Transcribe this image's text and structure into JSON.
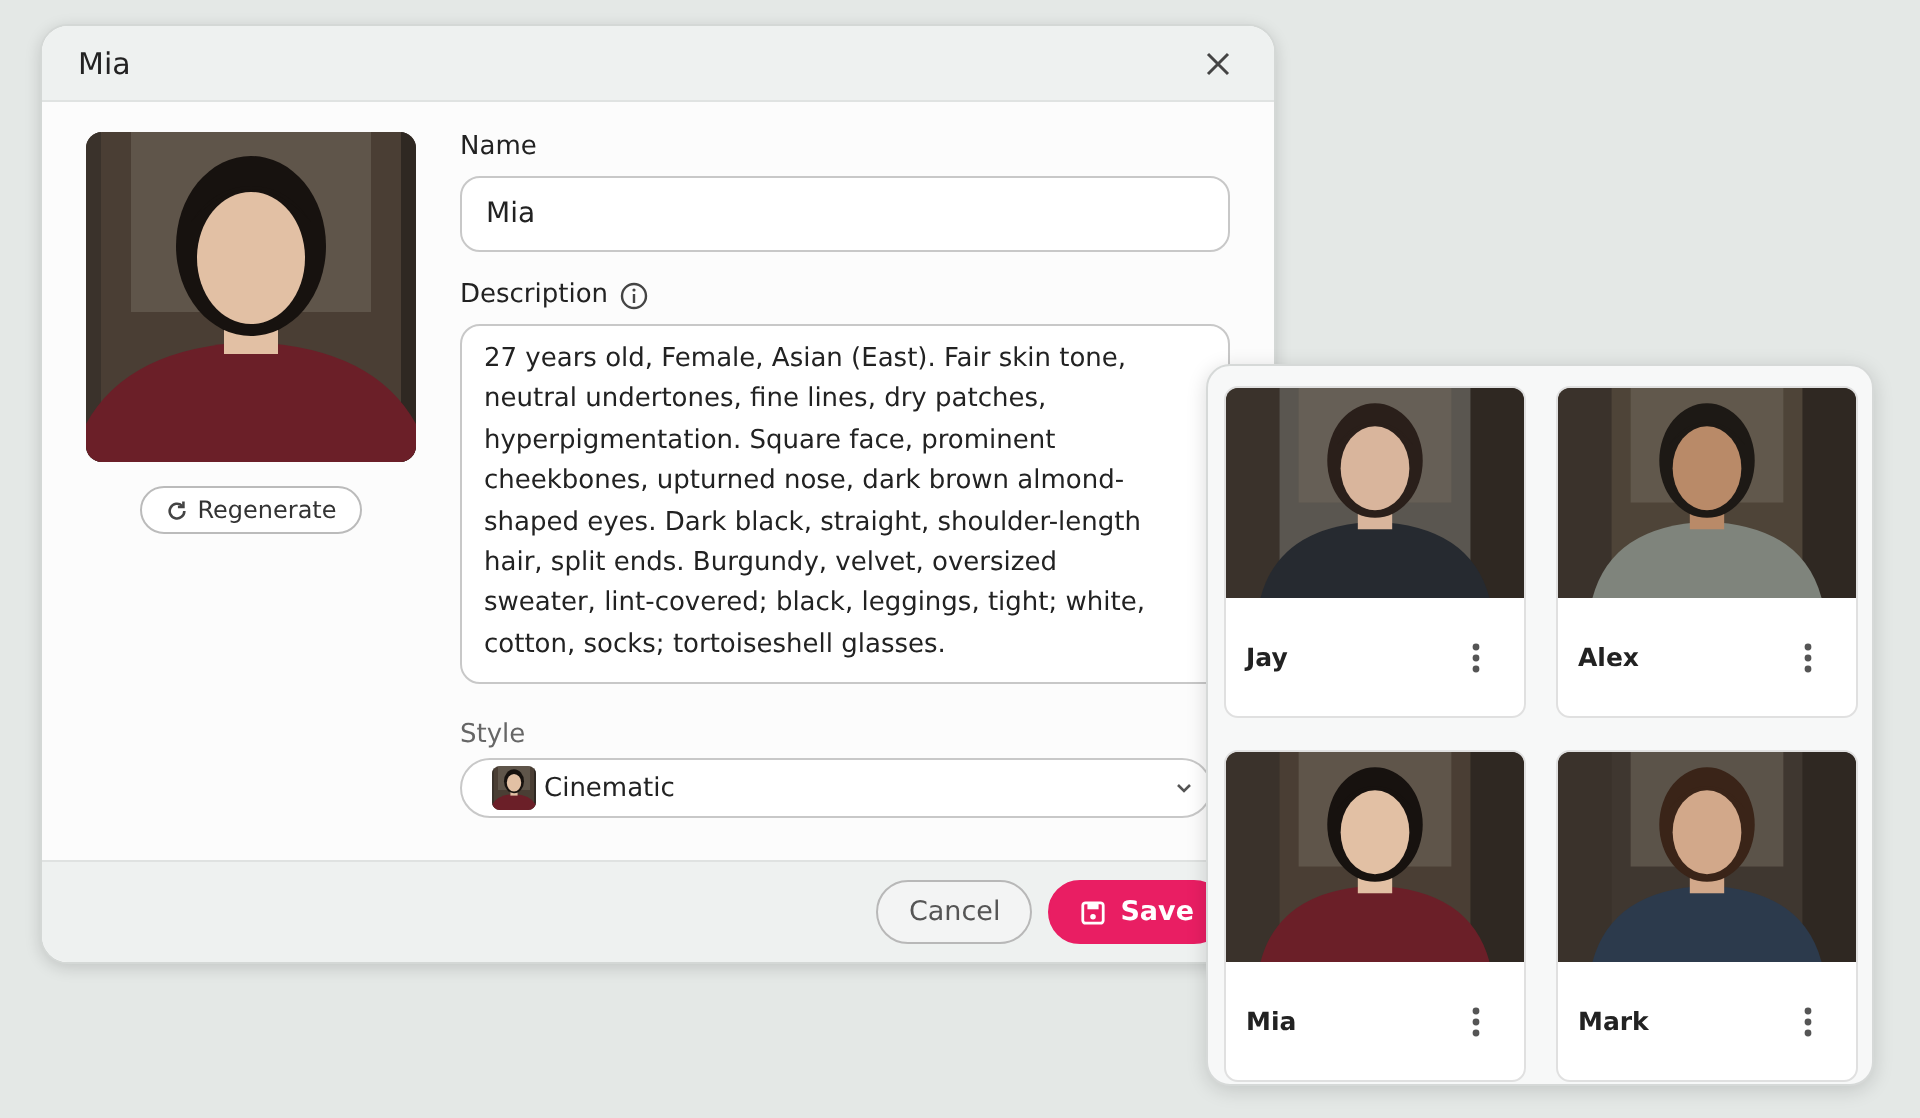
{
  "dialog": {
    "title": "Mia",
    "regenerate_button": "Regenerate",
    "name_field": {
      "label": "Name",
      "value": "Mia"
    },
    "description_field": {
      "label": "Description",
      "value": "27 years old, Female, Asian (East). Fair skin tone, neutral undertones, fine lines, dry patches, hyperpigmentation. Square face, prominent cheekbones, upturned nose, dark brown almond-shaped eyes. Dark black, straight, shoulder-length hair, split ends. Burgundy, velvet, oversized sweater, lint-covered; black, leggings, tight; white, cotton, socks; tortoiseshell glasses."
    },
    "style_field": {
      "label": "Style",
      "value": "Cinematic"
    },
    "buttons": [
      {
        "label": "Cancel",
        "kind": "secondary"
      },
      {
        "label": "Save",
        "kind": "primary"
      }
    ]
  },
  "characters": [
    {
      "name": "Jay"
    },
    {
      "name": "Alex"
    },
    {
      "name": "Mia"
    },
    {
      "name": "Mark"
    }
  ]
}
